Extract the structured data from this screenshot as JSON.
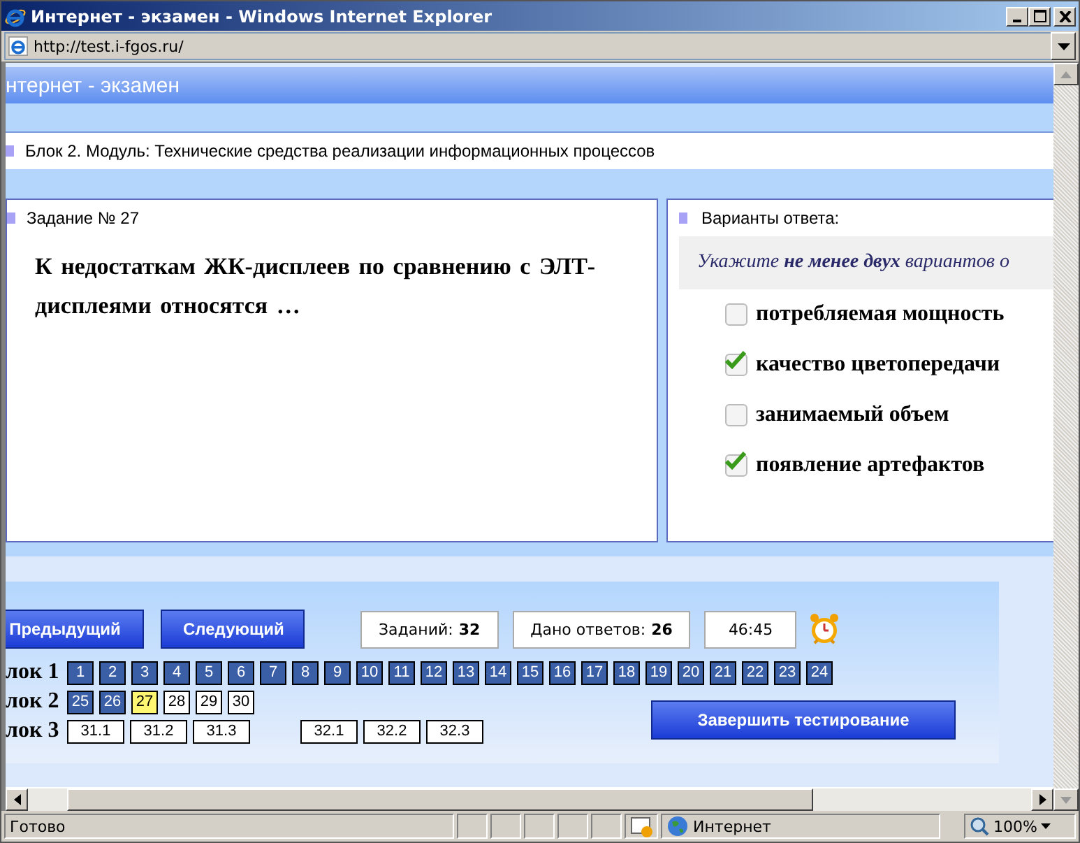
{
  "window": {
    "title": "Интернет - экзамен - Windows Internet Explorer"
  },
  "address_bar": {
    "url": "http://test.i-fgos.ru/"
  },
  "page": {
    "header": "нтернет - экзамен",
    "block_title": "Блок 2. Модуль: Технические средства реализации информационных процессов",
    "task": {
      "title": "Задание № 27",
      "question": "К недостаткам  ЖК-дисплеев по сравнению с ЭЛТ-дисплеями относятся …"
    },
    "answers": {
      "title": "Варианты ответа:",
      "instruction": "Укажите **не менее двух** вариантов о",
      "options": [
        {
          "label": "потребляемая мощность",
          "checked": false
        },
        {
          "label": "качество цветопередачи",
          "checked": true
        },
        {
          "label": "занимаемый объем",
          "checked": false
        },
        {
          "label": "появление артефактов",
          "checked": true
        }
      ]
    },
    "buttons": {
      "previous": "Предыдущий",
      "next": "Следующий",
      "finish": "Завершить тестирование"
    },
    "counters": [
      {
        "label": "Заданий:",
        "value": "32"
      },
      {
        "label": "Дано ответов:",
        "value": "26"
      }
    ],
    "timer": "46:45",
    "blocks": [
      {
        "label": "лок 1",
        "groups": [
          [
            {
              "n": "1",
              "answered": true,
              "selected": false
            },
            {
              "n": "2",
              "answered": true,
              "selected": false
            },
            {
              "n": "3",
              "answered": true,
              "selected": false
            },
            {
              "n": "4",
              "answered": true,
              "selected": false
            },
            {
              "n": "5",
              "answered": true,
              "selected": false
            },
            {
              "n": "6",
              "answered": true,
              "selected": false
            },
            {
              "n": "7",
              "answered": true,
              "selected": false
            },
            {
              "n": "8",
              "answered": true,
              "selected": false
            },
            {
              "n": "9",
              "answered": true,
              "selected": false
            },
            {
              "n": "10",
              "answered": true,
              "selected": false
            },
            {
              "n": "11",
              "answered": true,
              "selected": false
            },
            {
              "n": "12",
              "answered": true,
              "selected": false
            },
            {
              "n": "13",
              "answered": true,
              "selected": false
            },
            {
              "n": "14",
              "answered": true,
              "selected": false
            },
            {
              "n": "15",
              "answered": true,
              "selected": false
            },
            {
              "n": "16",
              "answered": true,
              "selected": false
            },
            {
              "n": "17",
              "answered": true,
              "selected": false
            },
            {
              "n": "18",
              "answered": true,
              "selected": false
            },
            {
              "n": "19",
              "answered": true,
              "selected": false
            },
            {
              "n": "20",
              "answered": true,
              "selected": false
            },
            {
              "n": "21",
              "answered": true,
              "selected": false
            },
            {
              "n": "22",
              "answered": true,
              "selected": false
            },
            {
              "n": "23",
              "answered": true,
              "selected": false
            },
            {
              "n": "24",
              "answered": true,
              "selected": false
            }
          ]
        ]
      },
      {
        "label": "лок 2",
        "groups": [
          [
            {
              "n": "25",
              "answered": true,
              "selected": false
            },
            {
              "n": "26",
              "answered": true,
              "selected": false
            },
            {
              "n": "27",
              "answered": false,
              "selected": true
            },
            {
              "n": "28",
              "answered": false,
              "selected": false
            },
            {
              "n": "29",
              "answered": false,
              "selected": false
            },
            {
              "n": "30",
              "answered": false,
              "selected": false
            }
          ]
        ]
      },
      {
        "label": "лок 3",
        "groups": [
          [
            {
              "n": "31.1",
              "answered": false,
              "selected": false
            },
            {
              "n": "31.2",
              "answered": false,
              "selected": false
            },
            {
              "n": "31.3",
              "answered": false,
              "selected": false
            }
          ],
          [
            {
              "n": "32.1",
              "answered": false,
              "selected": false
            },
            {
              "n": "32.2",
              "answered": false,
              "selected": false
            },
            {
              "n": "32.3",
              "answered": false,
              "selected": false
            }
          ]
        ]
      }
    ]
  },
  "status_bar": {
    "text": "Готово",
    "zone": "Интернет",
    "zoom": "100%"
  }
}
